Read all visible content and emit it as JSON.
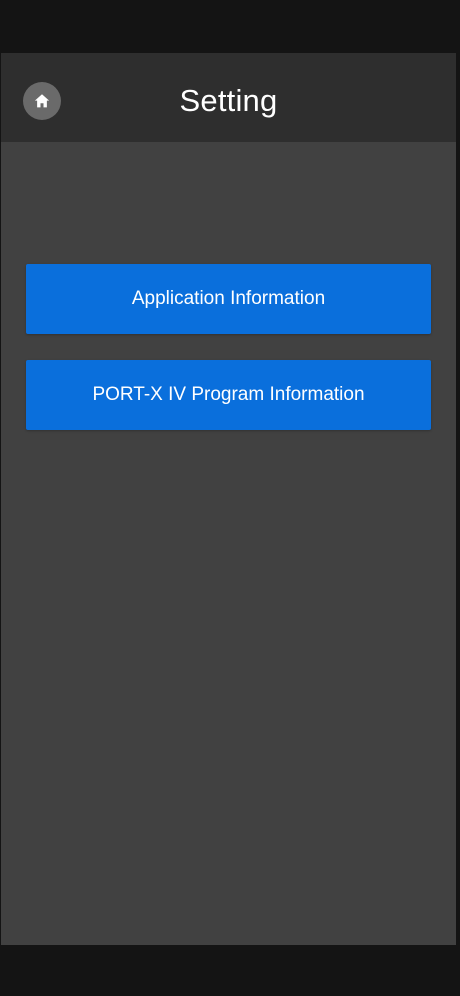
{
  "header": {
    "title": "Setting",
    "home_icon": "home-icon"
  },
  "menu": {
    "items": [
      {
        "label": "Application Information"
      },
      {
        "label": "PORT-X IV Program Information"
      }
    ]
  },
  "colors": {
    "background": "#414141",
    "header": "#2e2e2e",
    "button": "#0a6fdc",
    "frame": "#141414"
  }
}
